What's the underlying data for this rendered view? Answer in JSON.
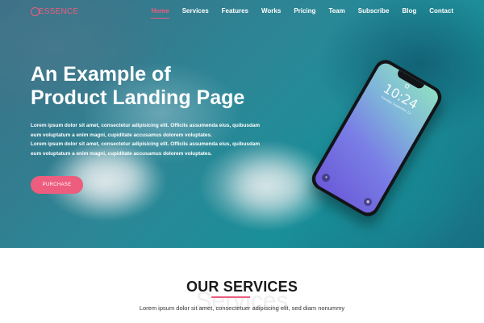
{
  "brand": {
    "name": "ESSENCE",
    "accent_color": "#ec5d7e"
  },
  "nav": {
    "items": [
      {
        "label": "Home",
        "active": true
      },
      {
        "label": "Services",
        "active": false
      },
      {
        "label": "Features",
        "active": false
      },
      {
        "label": "Works",
        "active": false
      },
      {
        "label": "Pricing",
        "active": false
      },
      {
        "label": "Team",
        "active": false
      },
      {
        "label": "Subscribe",
        "active": false
      },
      {
        "label": "Blog",
        "active": false
      },
      {
        "label": "Contact",
        "active": false
      }
    ]
  },
  "hero": {
    "title_line1": "An Example of",
    "title_line2": "Product Landing Page",
    "paragraph_lines": [
      "Lorem ipsum dolor sit amet, consectetur adipisicing elit. Officiis assumenda eius, quibusdam",
      "eum voluptatum a enim magni, cupiditate accusamus dolorem voluptates.",
      "Lorem ipsum dolor sit amet, consectetur adipisicing elit. Officiis assumenda eius, quibusdam",
      "eum voluptatum a enim magni, cupiditate accusamus dolorem voluptates."
    ],
    "button_label": "PURCHASE"
  },
  "phone": {
    "time": "10:24",
    "date": "Tuesday, September 12",
    "flash_icon": "flashlight-icon",
    "camera_icon": "camera-icon"
  },
  "services": {
    "title": "OUR SERVICES",
    "ghost_text": "Services",
    "subtitle": "Lorem ipsum dolor sit amet, consectetuer adipiscing elit, sed diam nonummy"
  }
}
